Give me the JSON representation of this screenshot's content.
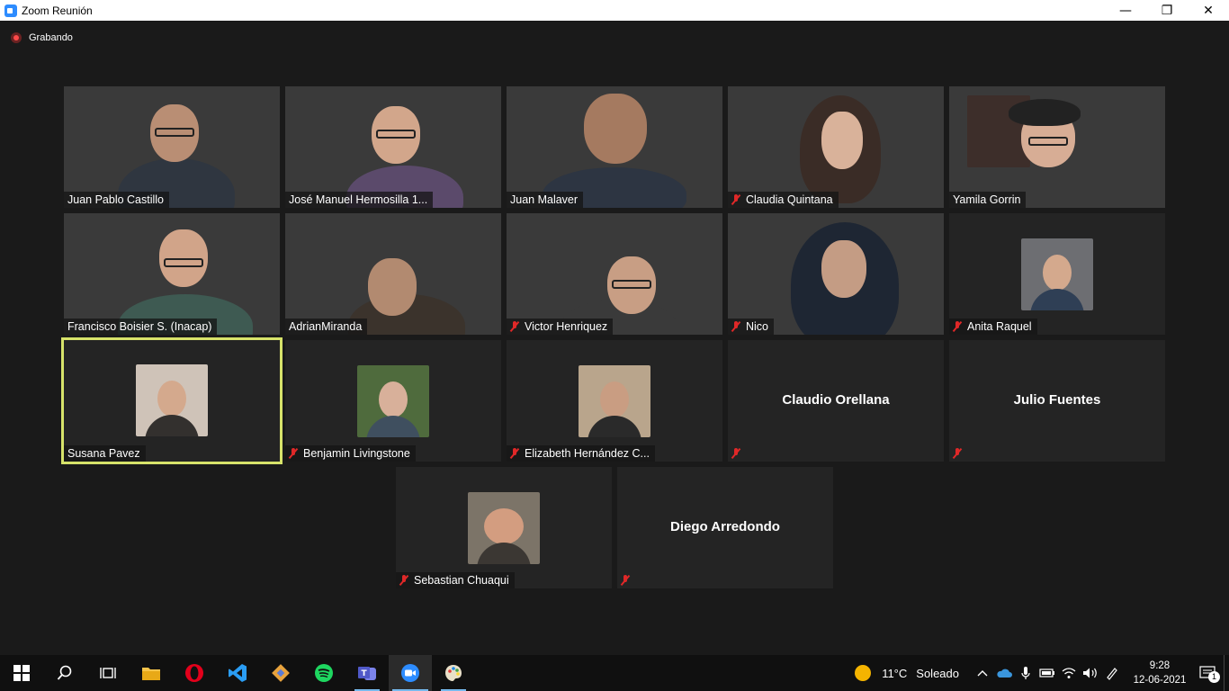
{
  "window": {
    "title": "Zoom Reunión",
    "minimize_glyph": "—",
    "restore_glyph": "❐",
    "close_glyph": "✕"
  },
  "recording": {
    "label": "Grabando"
  },
  "participants": [
    {
      "name": "Juan Pablo Castillo",
      "muted": false,
      "video": true
    },
    {
      "name": "José Manuel Hermosilla 1...",
      "muted": false,
      "video": true
    },
    {
      "name": "Juan Malaver",
      "muted": false,
      "video": true
    },
    {
      "name": "Claudia Quintana",
      "muted": true,
      "video": true
    },
    {
      "name": "Yamila Gorrin",
      "muted": false,
      "video": true
    },
    {
      "name": "Francisco Boisier S. (Inacap)",
      "muted": false,
      "video": true
    },
    {
      "name": "AdrianMiranda",
      "muted": false,
      "video": true
    },
    {
      "name": "Victor Henriquez",
      "muted": true,
      "video": true
    },
    {
      "name": "Nico",
      "muted": true,
      "video": true
    },
    {
      "name": "Anita Raquel",
      "muted": true,
      "video": false
    },
    {
      "name": "Susana Pavez",
      "muted": false,
      "video": false,
      "active_speaker": true
    },
    {
      "name": "Benjamin Livingstone",
      "muted": true,
      "video": false
    },
    {
      "name": "Elizabeth Hernández C...",
      "muted": true,
      "video": false
    },
    {
      "name": "Claudio Orellana",
      "muted": true,
      "video": false
    },
    {
      "name": "Julio Fuentes",
      "muted": true,
      "video": false
    },
    {
      "name": "Sebastian Chuaqui",
      "muted": true,
      "video": false
    },
    {
      "name": "Diego Arredondo",
      "muted": true,
      "video": false
    }
  ],
  "taskbar": {
    "apps": [
      "start-windows",
      "search",
      "task-view",
      "file-explorer",
      "opera",
      "vscode",
      "git",
      "spotify",
      "teams",
      "zoom",
      "paint"
    ],
    "weather": {
      "temp": "11°C",
      "condition": "Soleado"
    },
    "clock": {
      "time": "9:28",
      "date": "12-06-2021"
    },
    "notifications": "1"
  },
  "colors": {
    "background": "#1a1a1a",
    "tile": "#242424",
    "active_speaker": "#d7e36a",
    "mute_red": "#e02828",
    "taskbar": "#101010",
    "zoom_blue": "#2d8cff"
  }
}
